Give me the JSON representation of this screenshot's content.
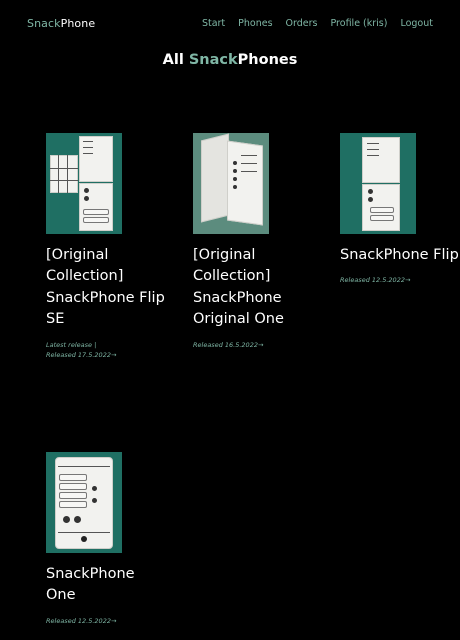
{
  "nav": {
    "brand_accent": "Snack",
    "brand_rest": "Phone",
    "links": [
      "Start",
      "Phones",
      "Orders",
      "Profile (kris)",
      "Logout"
    ]
  },
  "page": {
    "title_prefix": "All ",
    "title_accent": "Snack",
    "title_rest": "Phones"
  },
  "colors": {
    "accent": "#7fb6a5",
    "background": "#000000",
    "thumb_bg": "#1f6f63"
  },
  "products": [
    {
      "title": "[Original Collection] SnackPhone Flip SE",
      "meta_line1": "Latest release |",
      "meta_line2": "Released 17.5.2022→",
      "image": "paper-prototype-flip-se"
    },
    {
      "title": "[Original Collection] SnackPhone Original One",
      "meta_line1": "",
      "meta_line2": "Released 16.5.2022→",
      "image": "paper-prototype-original-one"
    },
    {
      "title": "SnackPhone Flip",
      "meta_line1": "",
      "meta_line2": "Released 12.5.2022→",
      "image": "paper-prototype-flip"
    },
    {
      "title": "SnackPhone One",
      "meta_line1": "",
      "meta_line2": "Released 12.5.2022→",
      "image": "paper-prototype-one"
    }
  ]
}
